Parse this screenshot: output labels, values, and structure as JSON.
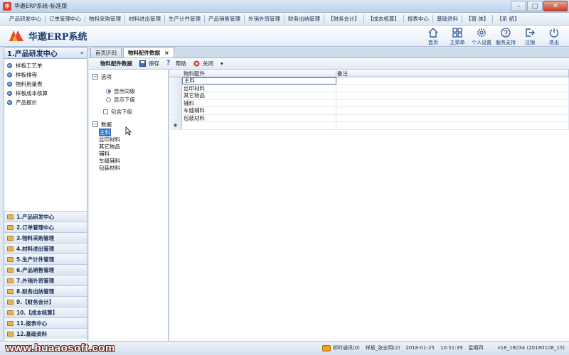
{
  "window": {
    "title": "华遨ERP系统-标准版",
    "app_icon_label": "华"
  },
  "menu": [
    "产品研发中心",
    "订单管理中心",
    "物料采购管理",
    "材料进出管理",
    "生产计件管理",
    "产品销售管理",
    "外销外贸管理",
    "财务出纳管理",
    "【财务会计】",
    "【成本核算】",
    "报表中心",
    "基础资料",
    "【窗 体】",
    "【系 统】"
  ],
  "header": {
    "logo_text": "华遨ERP系统",
    "tools": [
      {
        "label": "首页",
        "icon": "home-icon"
      },
      {
        "label": "主菜单",
        "icon": "grid-icon"
      },
      {
        "label": "个人设置",
        "icon": "gear-icon"
      },
      {
        "label": "服务支持",
        "icon": "support-icon"
      },
      {
        "label": "注销",
        "icon": "logout-icon"
      },
      {
        "label": "退出",
        "icon": "power-icon"
      }
    ]
  },
  "sidebar": {
    "title": "1.产品研发中心",
    "collapse": "«",
    "items": [
      "样板工艺单",
      "样板排程",
      "物料用量表",
      "样板成本核算",
      "产品报价"
    ],
    "modules": [
      "1.产品研发中心",
      "2.订单管理中心",
      "3.物料采购管理",
      "4.材料进出管理",
      "5.生产计件管理",
      "6.产品销售管理",
      "7.外销外贸管理",
      "8.财务出纳管理",
      "9.【财务会计】",
      "10.【成本核算】",
      "11.报表中心",
      "12.基础资料"
    ]
  },
  "tabs": [
    {
      "label": "首页[F8]",
      "active": false
    },
    {
      "label": "物料配件数据",
      "active": true,
      "close": "×"
    }
  ],
  "toolbar": {
    "title": "物料配件数据",
    "save": "保存",
    "help": "帮助",
    "close": "关闭",
    "more": "▾"
  },
  "options": {
    "group_label": "选项",
    "radio_same": "显示同级",
    "radio_sub": "显示下级",
    "check_include": "包含下级"
  },
  "data_tree": {
    "group_label": "数据",
    "items": [
      "主料",
      "丝印材料",
      "其它物品",
      "辅料",
      "车缝辅料",
      "包装材料"
    ],
    "selected_index": 0
  },
  "grid": {
    "columns": [
      "物料配件",
      "备注"
    ],
    "rows": [
      "主料",
      "丝印材料",
      "其它物品",
      "辅料",
      "车缝辅料",
      "包装材料"
    ],
    "new_row_marker": "✱",
    "group_toggle": "−"
  },
  "status": {
    "watermark": "www.huaaosoft.com",
    "im": "即时通讯(0)",
    "user": "样板_张志明(2)",
    "date": "2018-01-25",
    "time": "10:51:39",
    "weekday": "星期四",
    "version": "v18_18034 (20180108_15)"
  }
}
